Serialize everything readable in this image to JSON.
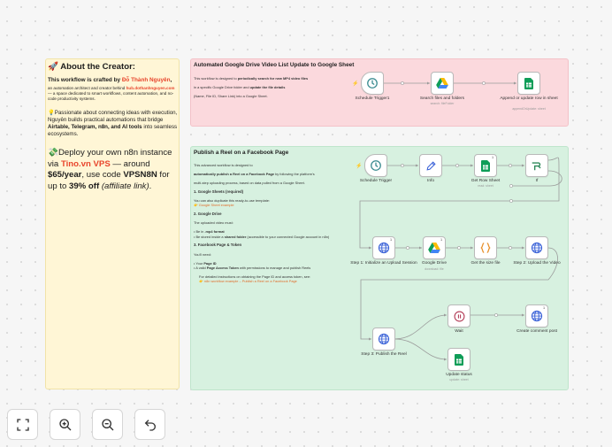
{
  "creator_note": {
    "heading": "🚀 About the Creator:",
    "line1_prefix": "This workflow is crafted by ",
    "author": "Đỗ Thành Nguyên",
    "line1_suffix": ",",
    "desc_prefix": "an automation architect and creator behind ",
    "site": "hub.dothanhnguyen.com",
    "desc_suffix": " — a space dedicated to smart workflows, content automation, and no-code productivity systems.",
    "passion_prefix": "💡Passionate about connecting ideas with execution, Nguyên builds practical automations that bridge ",
    "passion_tools": "Airtable, Telegram, n8n, and AI tools",
    "passion_suffix": " into seamless ecosystems.",
    "promo_prefix": "💸Deploy your own n8n instance via ",
    "promo_vps": "Tino.vn VPS",
    "promo_mid": " — around ",
    "promo_price": "$65/year",
    "promo_mid2": ", use code ",
    "promo_code": "VPSN8N",
    "promo_mid3": " for up to ",
    "promo_discount": "39% off",
    "promo_aff": "(affiliate link)",
    "promo_end": "."
  },
  "drive_note": {
    "title": "Automated Google Drive Video List Update to Google Sheet",
    "l1_prefix": "This workflow is designed to ",
    "l1_bold": "periodically search for new MP4 video files",
    "l2_prefix": "in a specific Google Drive folder and ",
    "l2_bold": "update the file details",
    "l3": "(Name, File ID, Share Link) into a Google Sheet."
  },
  "reel_note": {
    "title": "Publish a Reel on a Facebook Page",
    "p1": "This advanced workflow is designed to",
    "p1b_bold": "automatically publish a Reel on a Facebook Page",
    "p1b_rest": " by following the platform's",
    "p1c": "multi-step uploading process, based on data pulled from a Google Sheet.",
    "h1": "1. Google Sheets (required)",
    "s1a": "You can also duplicate this ready-to-use template:",
    "s1b": "👉 Google Sheet example",
    "h2": "2. Google Drive",
    "s2a": "The uploaded video must:",
    "s2b_prefix": "Be in ",
    "s2b_bold": ".mp4 format",
    "s2c_prefix": "Be stored inside a ",
    "s2c_bold": "shared folder",
    "s2c_rest": " (accessible to your connected Google account in n8n)",
    "h3": "3. Facebook Page & Token",
    "s3a": "You'll need:",
    "s3b_prefix": "Your ",
    "s3b_bold": "Page ID",
    "s3c_prefix": "A valid ",
    "s3c_bold": "Page Access Token",
    "s3c_rest": " with permissions to manage and publish Reels",
    "s3d": "For detailed instructions on obtaining the Page ID and access token, see:",
    "s3e": "👉 n8n workflow example – Publish a Reel on a Facebook Page"
  },
  "nodes": {
    "schedule1": {
      "label": "Schedule Trigger1"
    },
    "search": {
      "label": "Search files and folders",
      "sub": "search: fileFolder"
    },
    "append": {
      "label": "Append or update row in sheet",
      "sub": "appendOrUpdate: sheet"
    },
    "schedule2": {
      "label": "Schedule Trigger"
    },
    "info": {
      "label": "Info"
    },
    "getrow": {
      "label": "Get Row Sheet",
      "sub": "read: sheet",
      "count": "1"
    },
    "if": {
      "label": "If"
    },
    "step1": {
      "label": "Step 1: Initialize an Upload Session",
      "count": "1"
    },
    "gdrive": {
      "label": "Google Drive",
      "sub": "download: file",
      "count": "1"
    },
    "size": {
      "label": "Get the size file"
    },
    "step2": {
      "label": "Step 2: Upload the Video"
    },
    "step3": {
      "label": "Step 3: Publish the Reel"
    },
    "wait": {
      "label": "Wait"
    },
    "comment": {
      "label": "Create comment post",
      "count": "1"
    },
    "status": {
      "label": "Update status",
      "sub": "update: sheet"
    }
  },
  "colors": {
    "sheets_green": "#0f9d58",
    "http_blue": "#3d64d8",
    "wait_red": "#b23a55",
    "code_orange": "#e8912d",
    "if_green": "#2f8a5b",
    "trigger_teal": "#3a8b90"
  },
  "controls": {
    "fit": "fit-view-icon",
    "zoom_in": "zoom-in-icon",
    "zoom_out": "zoom-out-icon",
    "undo": "undo-icon"
  }
}
